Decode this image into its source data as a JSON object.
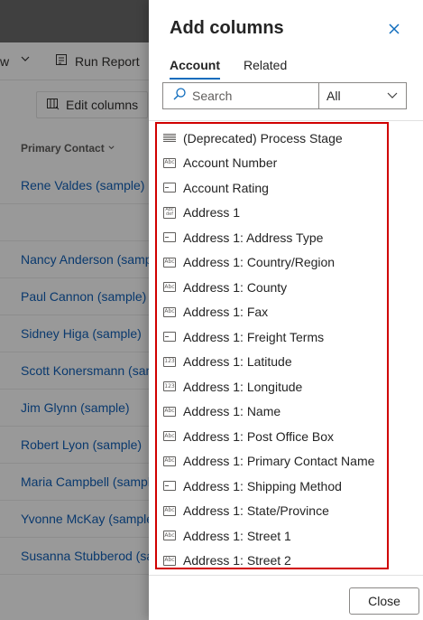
{
  "background": {
    "toolbar": {
      "view_fragment": "w",
      "run_report_label": "Run Report",
      "edit_columns_label": "Edit columns"
    },
    "column_header": "Primary Contact",
    "rows": [
      "Rene Valdes (sample)",
      "",
      "Nancy Anderson (samp",
      "Paul Cannon (sample)",
      "Sidney Higa (sample)",
      "Scott Konersmann (sam",
      "Jim Glynn (sample)",
      "Robert Lyon (sample)",
      "Maria Campbell (sample",
      "Yvonne McKay (sample)",
      "Susanna Stubberod (sar"
    ]
  },
  "panel": {
    "title": "Add columns",
    "tabs": [
      {
        "label": "Account",
        "active": true
      },
      {
        "label": "Related",
        "active": false
      }
    ],
    "search": {
      "placeholder": "Search",
      "value": ""
    },
    "filter": {
      "selected": "All"
    },
    "fields": [
      {
        "label": "(Deprecated) Process Stage",
        "icon": "stage-icon"
      },
      {
        "label": "Account Number",
        "icon": "text-icon"
      },
      {
        "label": "Account Rating",
        "icon": "option-set-icon"
      },
      {
        "label": "Address 1",
        "icon": "multiline-text-icon"
      },
      {
        "label": "Address 1: Address Type",
        "icon": "option-set-icon"
      },
      {
        "label": "Address 1: Country/Region",
        "icon": "text-icon"
      },
      {
        "label": "Address 1: County",
        "icon": "text-icon"
      },
      {
        "label": "Address 1: Fax",
        "icon": "text-icon"
      },
      {
        "label": "Address 1: Freight Terms",
        "icon": "option-set-icon"
      },
      {
        "label": "Address 1: Latitude",
        "icon": "number-icon"
      },
      {
        "label": "Address 1: Longitude",
        "icon": "number-icon"
      },
      {
        "label": "Address 1: Name",
        "icon": "text-icon"
      },
      {
        "label": "Address 1: Post Office Box",
        "icon": "text-icon"
      },
      {
        "label": "Address 1: Primary Contact Name",
        "icon": "text-icon"
      },
      {
        "label": "Address 1: Shipping Method",
        "icon": "option-set-icon"
      },
      {
        "label": "Address 1: State/Province",
        "icon": "text-icon"
      },
      {
        "label": "Address 1: Street 1",
        "icon": "text-icon"
      },
      {
        "label": "Address 1: Street 2",
        "icon": "text-icon"
      }
    ],
    "icon_text": {
      "text": "Abc",
      "number": "123",
      "multi_top": "Abc",
      "multi_bottom": "def"
    },
    "close_button_label": "Close",
    "highlight_color": "#d00000",
    "accent_color": "#0f6cbd"
  }
}
